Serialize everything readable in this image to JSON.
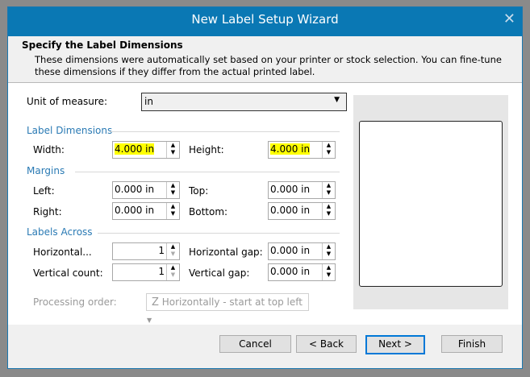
{
  "dialog": {
    "title": "New Label Setup Wizard",
    "close_icon": "close-icon",
    "heading": "Specify the Label Dimensions",
    "description": "These dimensions were automatically set based on your printer or stock selection. You can fine-tune these dimensions if they differ from the actual printed label."
  },
  "unit": {
    "label": "Unit of measure:",
    "value": "in"
  },
  "label_dimensions": {
    "title": "Label Dimensions",
    "width_label": "Width:",
    "width": "4.000 in",
    "height_label": "Height:",
    "height": "4.000 in"
  },
  "margins": {
    "title": "Margins",
    "left_label": "Left:",
    "left": "0.000 in",
    "top_label": "Top:",
    "top": "0.000 in",
    "right_label": "Right:",
    "right": "0.000 in",
    "bottom_label": "Bottom:",
    "bottom": "0.000 in"
  },
  "labels_across": {
    "title": "Labels Across",
    "horizontal_label": "Horizontal...",
    "horizontal": "1",
    "hgap_label": "Horizontal gap:",
    "hgap": "0.000 in",
    "vertical_label": "Vertical count:",
    "vertical": "1",
    "vgap_label": "Vertical gap:",
    "vgap": "0.000 in"
  },
  "processing": {
    "label": "Processing order:",
    "value": "Horizontally - start at top left"
  },
  "buttons": {
    "cancel": "Cancel",
    "back": "< Back",
    "next": "Next >",
    "finish": "Finish"
  },
  "highlight_color": "#ffff00",
  "accent": "#0a78b4"
}
